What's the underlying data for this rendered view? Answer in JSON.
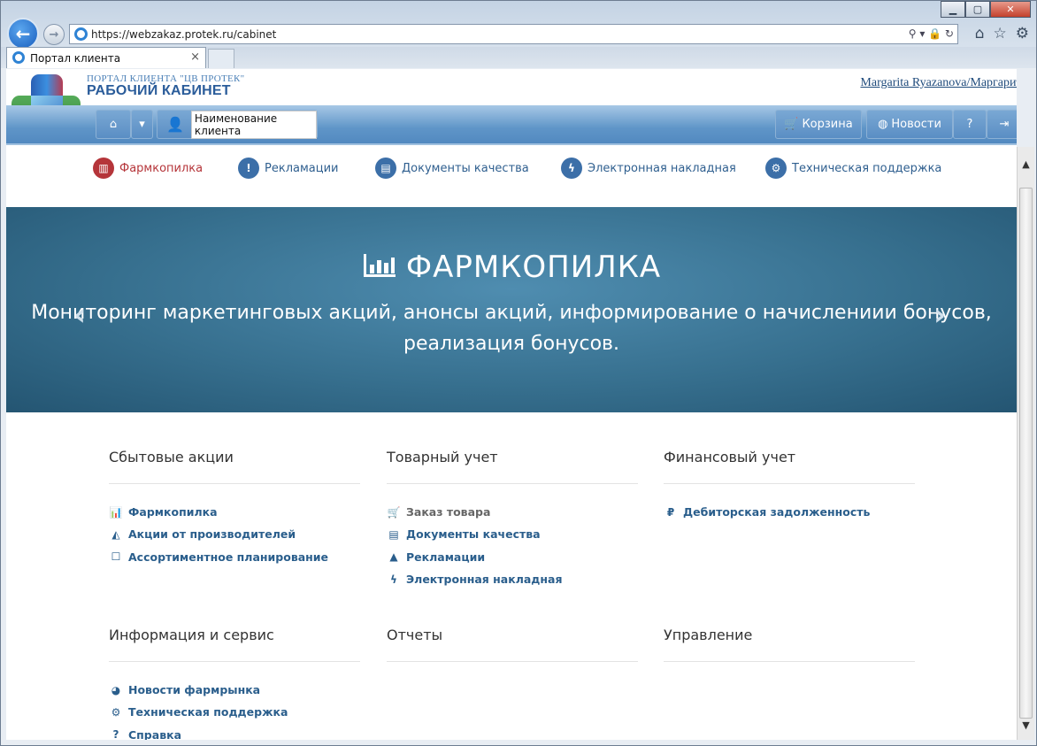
{
  "browser": {
    "url": "https://webzakaz.protek.ru/cabinet",
    "tab_title": "Портал клиента",
    "window_controls": [
      "minimize-icon",
      "maximize-icon",
      "close-icon"
    ],
    "toolbar_icons": [
      "home-icon",
      "star-icon",
      "gear-icon"
    ]
  },
  "header": {
    "portal_label": "ПОРТАЛ КЛИЕНТА \"ЦВ ПРОТЕК\"",
    "cabinet_label": "РАБОЧИЙ КАБИНЕТ",
    "user_link": "Margarita Ryazanova/Маргарита"
  },
  "toolbar": {
    "client_name_label": "Наименование клиента",
    "cart_label": "Корзина",
    "news_label": "Новости"
  },
  "menu": [
    {
      "label": "Фармкопилка",
      "icon": "bar-chart-icon",
      "active": true
    },
    {
      "label": "Рекламации",
      "icon": "warning-icon",
      "active": false
    },
    {
      "label": "Документы качества",
      "icon": "document-icon",
      "active": false
    },
    {
      "label": "Электронная накладная",
      "icon": "bolt-icon",
      "active": false
    },
    {
      "label": "Техническая поддержка",
      "icon": "cogs-icon",
      "active": false
    }
  ],
  "banner": {
    "title": "ФАРМКОПИЛКА",
    "description_line1": "Мониторинг маркетинговых акций, анонсы акций, информирование о начислениии бонусов,",
    "description_line2": "реализация бонусов.",
    "active_slide": 2,
    "slide_count": 2
  },
  "sections": [
    {
      "title": "Сбытовые акции",
      "items": [
        {
          "label": "Фармкопилка",
          "icon": "bar-chart-icon",
          "glyph": "📊"
        },
        {
          "label": "Акции от производителей",
          "icon": "area-chart-icon",
          "glyph": "◭"
        },
        {
          "label": "Ассортиментное планирование",
          "icon": "checkbox-icon",
          "glyph": "☐"
        }
      ]
    },
    {
      "title": "Товарный учет",
      "items": [
        {
          "label": "Заказ товара",
          "icon": "cart-icon",
          "glyph": "🛒",
          "muted": true
        },
        {
          "label": "Документы качества",
          "icon": "document-icon",
          "glyph": "▤"
        },
        {
          "label": "Рекламации",
          "icon": "warning-icon",
          "glyph": "▲"
        },
        {
          "label": "Электронная накладная",
          "icon": "bolt-icon",
          "glyph": "ϟ"
        }
      ]
    },
    {
      "title": "Финансовый учет",
      "items": [
        {
          "label": "Дебиторская задолженность",
          "icon": "ruble-icon",
          "glyph": "₽"
        }
      ]
    },
    {
      "title": "Информация и сервис",
      "items": [
        {
          "label": "Новости фармрынка",
          "icon": "globe-icon",
          "glyph": "◕"
        },
        {
          "label": "Техническая поддержка",
          "icon": "cogs-icon",
          "glyph": "⚙"
        },
        {
          "label": "Справка",
          "icon": "question-icon",
          "glyph": "?"
        }
      ]
    },
    {
      "title": "Отчеты",
      "items": []
    },
    {
      "title": "Управление",
      "items": []
    }
  ],
  "colors": {
    "accent": "#2a5e8c",
    "active": "#b5353a",
    "banner": "#37708f"
  }
}
